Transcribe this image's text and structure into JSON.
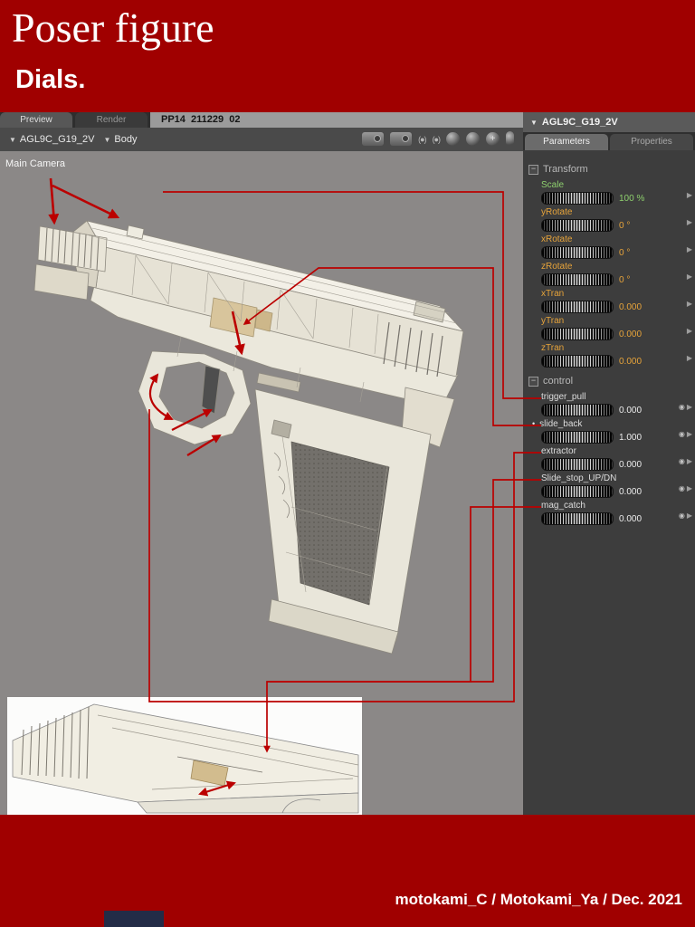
{
  "colors": {
    "banner_red": "#a00000",
    "annotation_red": "#bb0000",
    "viewport_gray": "#8b8887",
    "panel_dark": "#3d3d3d",
    "navy_box": "#232c47"
  },
  "banner": {
    "title": "Poser figure",
    "subtitle": "Dials.",
    "credit": "motokami_C / Motokami_Ya / Dec. 2021"
  },
  "viewport": {
    "tabs": [
      "Preview",
      "Render"
    ],
    "active_tab": "Preview",
    "doc_title": "PP14  211229  02",
    "figure_dropdown": "AGL9C_G19_2V",
    "body_dropdown": "Body",
    "camera_label": "Main Camera",
    "toolbar_icons": [
      "camera-icon",
      "camera-icon",
      "aperture-icon",
      "aperture-icon",
      "trackball-icon",
      "rotate-icon",
      "move-icon",
      "hand-icon"
    ]
  },
  "panel": {
    "header": "AGL9C_G19_2V",
    "tabs": [
      "Parameters",
      "Properties"
    ],
    "active_tab": "Parameters",
    "groups": [
      {
        "name": "Transform",
        "has_eye": false,
        "dials": [
          {
            "label": "Scale",
            "value": "100 %",
            "label_color": "#8ed06e",
            "value_color": "#8ed06e"
          },
          {
            "label": "yRotate",
            "value": "0 °",
            "label_color": "#e6a33a",
            "value_color": "#e6a33a"
          },
          {
            "label": "xRotate",
            "value": "0 °",
            "label_color": "#e6a33a",
            "value_color": "#e6a33a"
          },
          {
            "label": "zRotate",
            "value": "0 °",
            "label_color": "#e6a33a",
            "value_color": "#e6a33a"
          },
          {
            "label": "xTran",
            "value": "0.000",
            "label_color": "#e6a33a",
            "value_color": "#e6a33a"
          },
          {
            "label": "yTran",
            "value": "0.000",
            "label_color": "#e6a33a",
            "value_color": "#e6a33a"
          },
          {
            "label": "zTran",
            "value": "0.000",
            "label_color": "#e6a33a",
            "value_color": "#e6a33a"
          }
        ]
      },
      {
        "name": "control",
        "has_eye": true,
        "dials": [
          {
            "label": "trigger_pull",
            "value": "0.000",
            "label_color": "#dcdcdc",
            "value_color": "#ececec"
          },
          {
            "label": "slide_back",
            "value": "1.000",
            "label_color": "#dcdcdc",
            "value_color": "#ececec",
            "modified": true
          },
          {
            "label": "extractor",
            "value": "0.000",
            "label_color": "#dcdcdc",
            "value_color": "#ececec"
          },
          {
            "label": "Slide_stop_UP/DN",
            "value": "0.000",
            "label_color": "#dcdcdc",
            "value_color": "#ececec"
          },
          {
            "label": "mag_catch",
            "value": "0.000",
            "label_color": "#dcdcdc",
            "value_color": "#ececec"
          }
        ]
      }
    ]
  }
}
